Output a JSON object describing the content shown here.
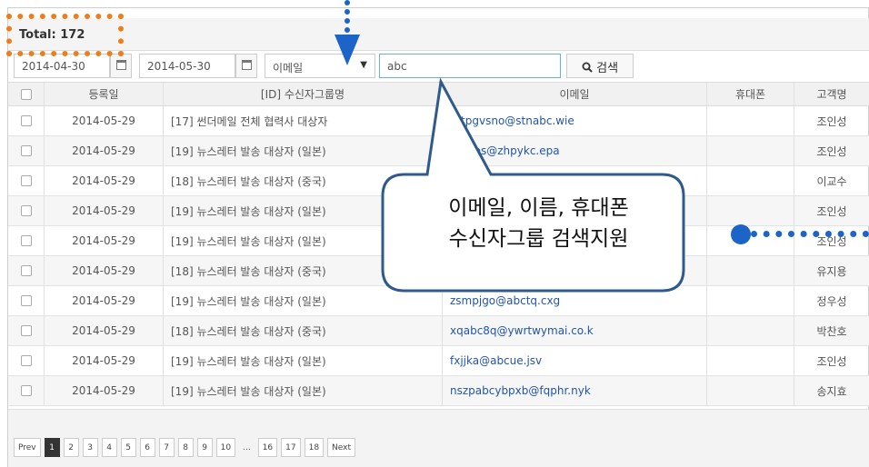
{
  "total_label": "Total: 172",
  "filters": {
    "start_date": "2014-04-30",
    "end_date": "2014-05-30",
    "search_field": "이메일",
    "search_query": "abc",
    "search_button": "검색"
  },
  "columns": [
    "등록일",
    "[ID] 수신자그룹명",
    "이메일",
    "휴대폰",
    "고객명"
  ],
  "rows": [
    {
      "date": "2014-05-29",
      "group": "[17] 썬더메일 전체 협력사 대상자",
      "email": "tatpgvsno@stnabc.wie",
      "phone": "",
      "name": "조인성"
    },
    {
      "date": "2014-05-29",
      "group": "[19] 뉴스레터 발송 대상자 (일본)",
      "email": "bomos@zhpykc.epa",
      "phone": "",
      "name": "조인성"
    },
    {
      "date": "2014-05-29",
      "group": "[18] 뉴스레터 발송 대상자 (중국)",
      "email": "",
      "phone": "",
      "name": "이교수"
    },
    {
      "date": "2014-05-29",
      "group": "[19] 뉴스레터 발송 대상자 (일본)",
      "email": "",
      "phone": "",
      "name": "조인성"
    },
    {
      "date": "2014-05-29",
      "group": "[19] 뉴스레터 발송 대상자 (일본)",
      "email": "",
      "phone": "",
      "name": "조인성"
    },
    {
      "date": "2014-05-29",
      "group": "[18] 뉴스레터 발송 대상자 (중국)",
      "email": "",
      "phone": "",
      "name": "유지용"
    },
    {
      "date": "2014-05-29",
      "group": "[19] 뉴스레터 발송 대상자 (일본)",
      "email": "zsmpjgo@abctq.cxg",
      "phone": "",
      "name": "정우성"
    },
    {
      "date": "2014-05-29",
      "group": "[18] 뉴스레터 발송 대상자 (중국)",
      "email": "xqabc8q@ywrtwymai.co.k",
      "phone": "",
      "name": "박찬호"
    },
    {
      "date": "2014-05-29",
      "group": "[19] 뉴스레터 발송 대상자 (일본)",
      "email": "fxjjka@abcue.jsv",
      "phone": "",
      "name": "조인성"
    },
    {
      "date": "2014-05-29",
      "group": "[19] 뉴스레터 발송 대상자 (일본)",
      "email": "nszpabcybpxb@fqphr.nyk",
      "phone": "",
      "name": "송지효"
    }
  ],
  "pagination": [
    "Prev",
    "1",
    "2",
    "3",
    "4",
    "5",
    "6",
    "7",
    "8",
    "9",
    "10",
    "...",
    "16",
    "17",
    "18",
    "Next"
  ],
  "active_page": "1",
  "callout": {
    "line1": "이메일, 이름, 휴대폰",
    "line2": "수신자그룹 검색지원"
  },
  "colors": {
    "orange_annotation": "#f07d1a",
    "blue_annotation": "#1c64c8",
    "callout_border": "#2f5a8c",
    "email_link": "#2255aa"
  }
}
